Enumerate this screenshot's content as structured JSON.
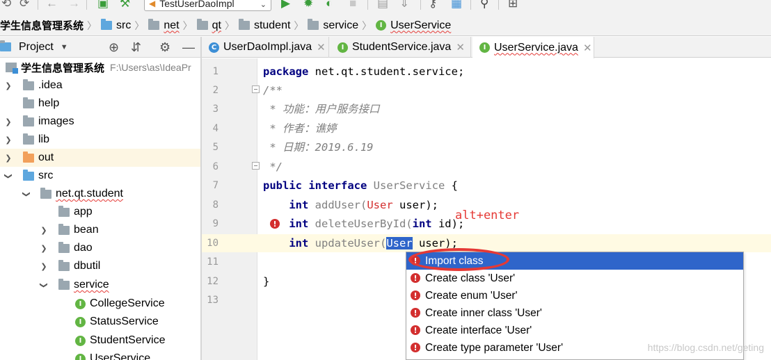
{
  "toolbar": {
    "run_config": "TestUserDaoImpl",
    "icons": [
      "undo-icon",
      "redo-icon",
      "run-arrow-icon",
      "build-hammer-icon",
      "run-icon",
      "debug-icon",
      "coverage-icon",
      "stop-icon",
      "search-icon"
    ]
  },
  "breadcrumb": {
    "items": [
      "学生信息管理系统",
      "src",
      "net",
      "qt",
      "student",
      "service",
      "UserService"
    ]
  },
  "project_panel": {
    "title": "Project",
    "root": {
      "name": "学生信息管理系统",
      "path": "F:\\Users\\as\\IdeaPr"
    },
    "items": [
      ".idea",
      "help",
      "images",
      "lib",
      "out",
      "src",
      "net.qt.student",
      "app",
      "bean",
      "dao",
      "dbutil",
      "service",
      "CollegeService",
      "StatusService",
      "StudentService",
      "UserService"
    ]
  },
  "tabs": [
    {
      "label": "UserDaoImpl.java",
      "icon": "class"
    },
    {
      "label": "StudentService.java",
      "icon": "interface"
    },
    {
      "label": "UserService.java",
      "icon": "interface",
      "active": true
    }
  ],
  "editor": {
    "line_numbers": [
      "1",
      "2",
      "3",
      "4",
      "5",
      "6",
      "7",
      "8",
      "9",
      "10",
      "11",
      "12",
      "13"
    ],
    "l1_kw": "package",
    "l1_rest": " net.qt.student.service;",
    "l2": "/**",
    "l3": " * 功能：用户服务接口",
    "l4": " * 作者：谯婷",
    "l5": " * 日期：2019.6.19",
    "l6": " */",
    "l7_kw1": "public",
    "l7_kw2": " interface",
    "l7_name": " UserService",
    "l7_rest": " {",
    "l8_kw": "    int",
    "l8_method": " addUser(",
    "l8_type": "User",
    "l8_rest": " user);",
    "l9_kw": "    int",
    "l9_method": " deleteUserById(",
    "l9_kw2": "int",
    "l9_rest": " id);",
    "l10_kw": "    int",
    "l10_method": " updateUser(",
    "l10_type": "User",
    "l10_rest": " user);",
    "l12": "}"
  },
  "annotation": "alt+enter",
  "popup": {
    "items": [
      "Import class",
      "Create class 'User'",
      "Create enum 'User'",
      "Create inner class 'User'",
      "Create interface 'User'",
      "Create type parameter 'User'"
    ]
  },
  "watermark": "https://blog.csdn.net/geting",
  "colors": {
    "selection": "#2f65ca",
    "error": "#d32f2f",
    "keyword": "#000080",
    "annotation_red": "#e53935"
  }
}
